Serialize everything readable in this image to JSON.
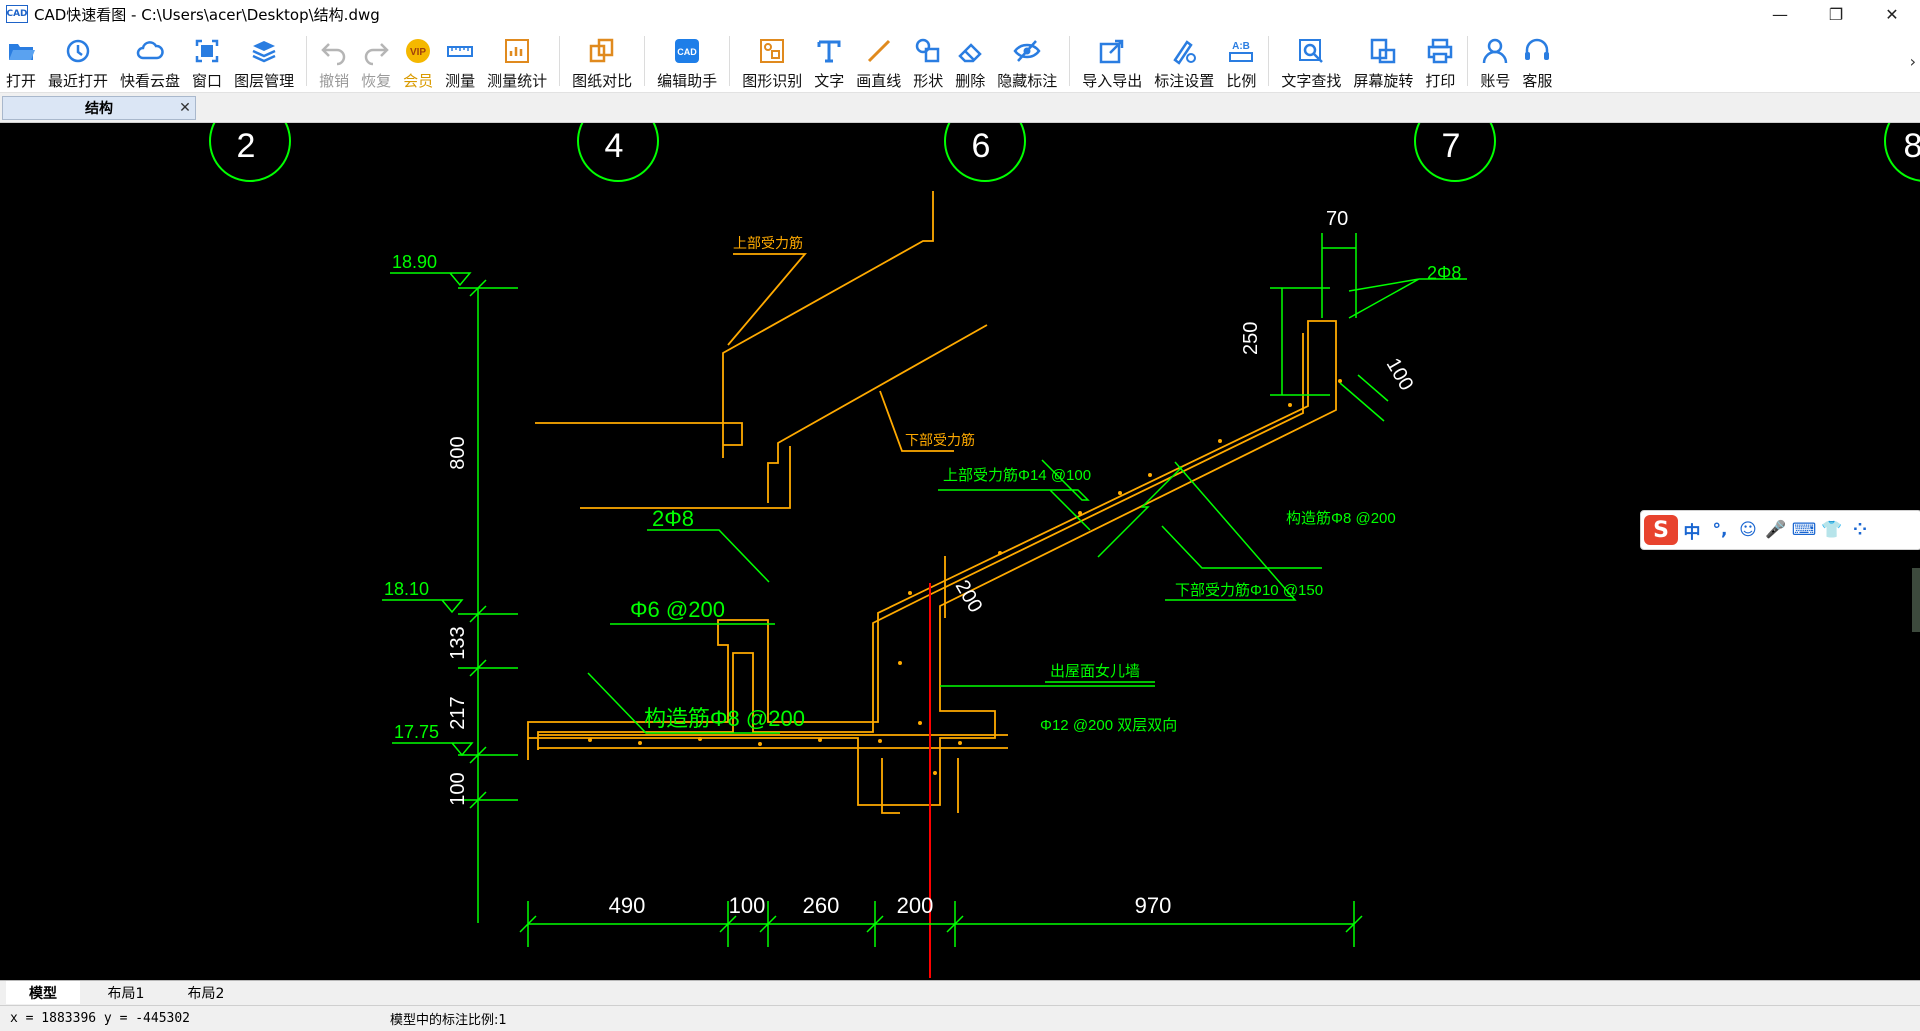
{
  "window": {
    "app_name": "CAD快速看图",
    "title": "CAD快速看图 - C:\\Users\\acer\\Desktop\\结构.dwg",
    "icon_text": "CAD",
    "minimize": "—",
    "restore": "❐",
    "close": "✕"
  },
  "toolbar": {
    "items": [
      {
        "label": "打开",
        "icon": "folder-open-icon",
        "enabled": true
      },
      {
        "label": "最近打开",
        "icon": "clock-history-icon",
        "enabled": true
      },
      {
        "label": "快看云盘",
        "icon": "cloud-icon",
        "enabled": true
      },
      {
        "label": "窗口",
        "icon": "window-fit-icon",
        "enabled": true
      },
      {
        "label": "图层管理",
        "icon": "layers-icon",
        "enabled": true
      },
      {
        "label": "撤销",
        "icon": "undo-icon",
        "enabled": false
      },
      {
        "label": "恢复",
        "icon": "redo-icon",
        "enabled": false
      },
      {
        "label": "会员",
        "icon": "vip-badge-icon",
        "enabled": true
      },
      {
        "label": "测量",
        "icon": "ruler-icon",
        "enabled": true
      },
      {
        "label": "测量统计",
        "icon": "measure-stats-icon",
        "enabled": true
      },
      {
        "label": "图纸对比",
        "icon": "compare-icon",
        "enabled": true
      },
      {
        "label": "编辑助手",
        "icon": "edit-assistant-icon",
        "enabled": true
      },
      {
        "label": "图形识别",
        "icon": "shape-recognize-icon",
        "enabled": true
      },
      {
        "label": "文字",
        "icon": "text-t-icon",
        "enabled": true
      },
      {
        "label": "画直线",
        "icon": "line-icon",
        "enabled": true
      },
      {
        "label": "形状",
        "icon": "shapes-icon",
        "enabled": true
      },
      {
        "label": "删除",
        "icon": "eraser-icon",
        "enabled": true
      },
      {
        "label": "隐藏标注",
        "icon": "eye-hide-icon",
        "enabled": true
      },
      {
        "label": "导入导出",
        "icon": "import-export-icon",
        "enabled": true
      },
      {
        "label": "标注设置",
        "icon": "annotation-settings-icon",
        "enabled": true
      },
      {
        "label": "比例",
        "icon": "scale-ab-icon",
        "enabled": true
      },
      {
        "label": "文字查找",
        "icon": "text-search-icon",
        "enabled": true
      },
      {
        "label": "屏幕旋转",
        "icon": "screen-rotate-icon",
        "enabled": true
      },
      {
        "label": "打印",
        "icon": "printer-icon",
        "enabled": true
      },
      {
        "label": "账号",
        "icon": "account-icon",
        "enabled": true
      },
      {
        "label": "客服",
        "icon": "headset-icon",
        "enabled": true
      }
    ],
    "more": "›"
  },
  "document_tab": {
    "label": "结构",
    "close": "✕"
  },
  "drawing": {
    "axis_labels": [
      "2",
      "4",
      "6",
      "7",
      "8"
    ],
    "elevations": [
      "18.90",
      "18.10",
      "17.75"
    ],
    "vertical_dims": [
      "800",
      "133",
      "217",
      "100"
    ],
    "bottom_dims": [
      "490",
      "100",
      "260",
      "200",
      "970"
    ],
    "right_dims": [
      "70",
      "250",
      "100"
    ],
    "diag_dim": "200",
    "rebar_labels": {
      "upper_main": "上部受力筋",
      "lower_main": "下部受力筋",
      "upper_main_spec": "上部受力筋Φ14 @100",
      "lower_main_spec": "下部受力筋Φ10 @150",
      "dist_bar": "构造筋Φ8 @200",
      "top_bars": "2Φ8",
      "left_bars": "2Φ8",
      "stirrup": "Φ6 @200",
      "bottom_dist": "构造筋Φ8 @200",
      "wall_bars": "出屋面女儿墙",
      "wall_spec": "Φ12 @200 双层双向"
    }
  },
  "ime": {
    "logo": "S",
    "items": [
      "中",
      "°,",
      "☺",
      "🎤",
      "⌨",
      "👕",
      "⁘"
    ]
  },
  "layout_tabs": [
    "模型",
    "布局1",
    "布局2"
  ],
  "status": {
    "coords": "x = 1883396  y = -445302",
    "scale": "模型中的标注比例:1"
  },
  "colors": {
    "canvas": "#000000",
    "green": "#00ff00",
    "yellow": "#ffaa00",
    "white": "#ffffff",
    "red": "#ff0000"
  }
}
